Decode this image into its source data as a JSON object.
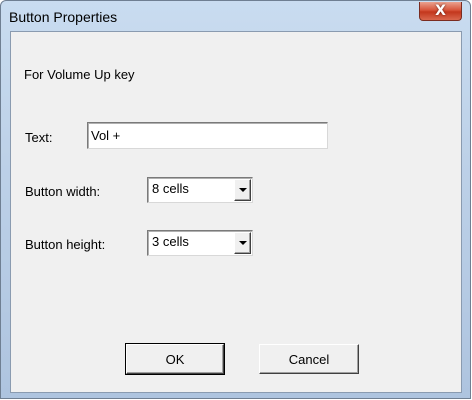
{
  "window": {
    "title": "Button Properties",
    "close_glyph": "X"
  },
  "dialog": {
    "description": "For Volume Up key",
    "text_label": "Text:",
    "text_value": "Vol +",
    "width_label": "Button width:",
    "width_value": "8 cells",
    "height_label": "Button height:",
    "height_value": "3 cells",
    "ok_label": "OK",
    "cancel_label": "Cancel"
  },
  "icons": {
    "close": "close-icon",
    "dropdown": "chevron-down-icon"
  }
}
